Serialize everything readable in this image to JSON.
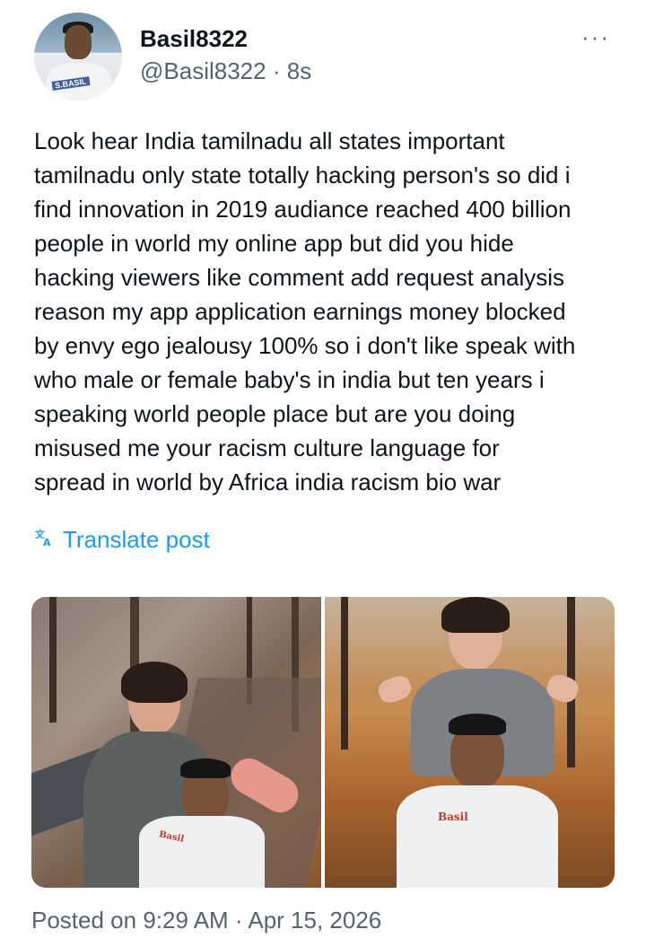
{
  "author": {
    "display_name": "Basil8322",
    "handle": "@Basil8322",
    "separator": "·",
    "age": "8s",
    "avatar_label": "S.BASIL"
  },
  "post": {
    "more_label": "···",
    "text": "Look hear India tamilnadu all states important\ntamilnadu only state totally hacking person's so did i\nfind innovation in 2019 audiance reached 400 billion\npeople in world my online app but did you hide\nhacking viewers like comment add request analysis\nreason my app application earnings money blocked\nby envy ego jealousy 100% so i don't like speak with\nwho male or female baby's in india but ten years i\nspeaking world people place but are you doing\nmisused me your racism culture language for\nspread in world by Africa india racism bio war",
    "translate_label": "Translate post",
    "photos": [
      {
        "badge": "Basil"
      },
      {
        "badge": "Basil"
      }
    ],
    "posted_label": "Posted on 9:29 AM · Apr 15, 2026"
  },
  "colors": {
    "link": "#1d9bf0",
    "secondary_text": "#536471",
    "primary_text": "#0f1419"
  },
  "icons": {
    "translate": "translate-icon",
    "more": "more-options-icon"
  }
}
